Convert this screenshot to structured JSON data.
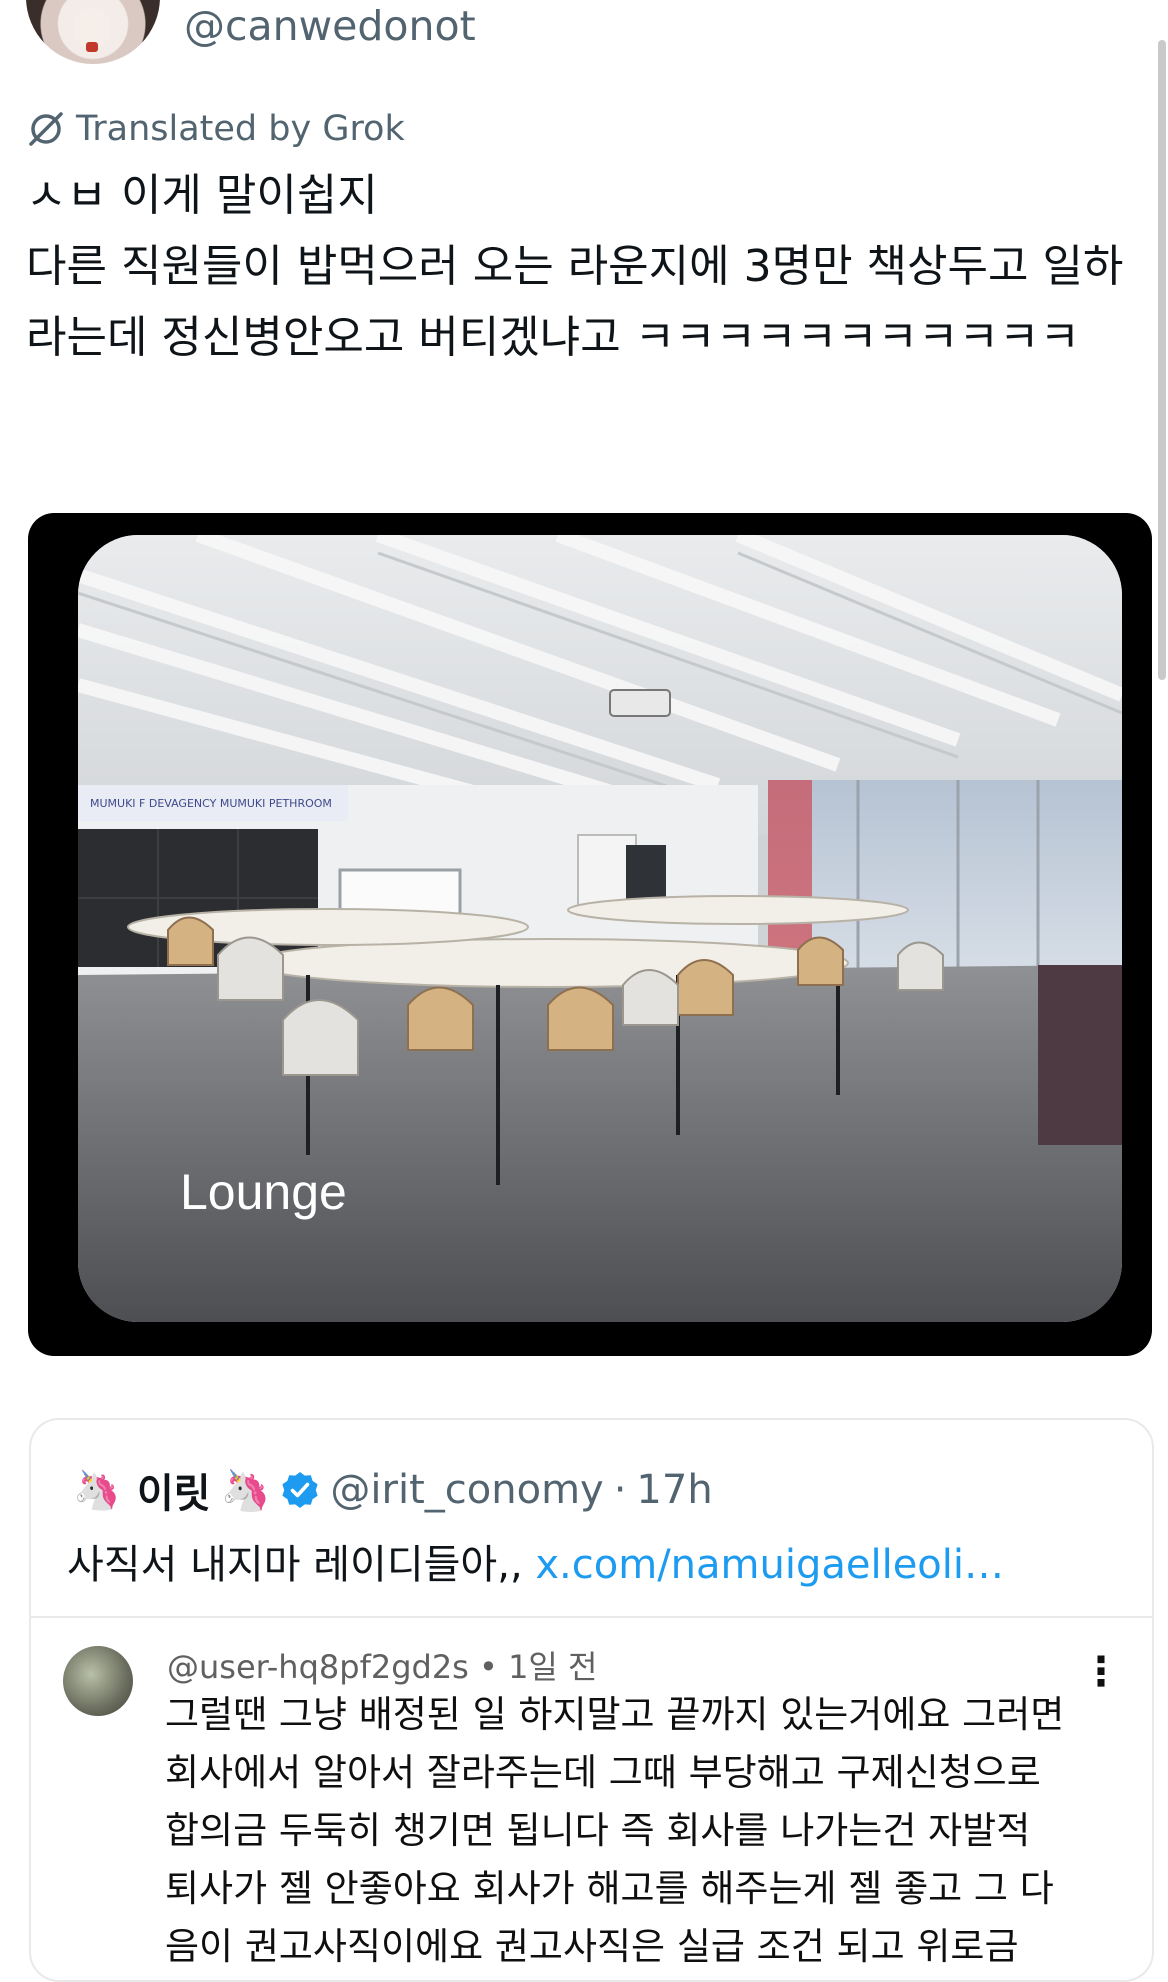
{
  "tweet": {
    "handle": "@canwedonot",
    "translated_label": "Translated by Grok",
    "text": "ㅅㅂ 이게 말이쉽지\n다른 직원들이 밥먹으러 오는 라운지에 3명만 책상두고 일하라는데 정신병안오고 버티겠냐고 ㅋㅋㅋㅋㅋㅋㅋㅋㅋㅋㅋ",
    "image_caption": "Lounge",
    "image_signage": "MUMUKI   F  DEVAGENCY   MUMUKI   PETHROOM"
  },
  "quote": {
    "name": "이릿",
    "name_emoji": "🦄",
    "avatar_emoji": "🦄",
    "handle": "@irit_conomy",
    "separator": "·",
    "time": "17h",
    "text": "사직서 내지마 레이디들아,, ",
    "link": "x.com/namuigaelleoli…",
    "embedded_comment": {
      "user": "@user-hq8pf2gd2s",
      "meta_sep": "•",
      "time": "1일 전",
      "more": "⋮",
      "text": "그럴땐 그냥 배정된 일 하지말고 끝까지 있는거에요 그러면 회사에서 알아서 잘라주는데 그때 부당해고 구제신청으로 합의금 두둑히 챙기면 됩니다 즉 회사를 나가는건 자발적 퇴사가 젤 안좋아요 회사가 해고를 해주는게 젤 좋고 그 다음이 권고사직이에요 권고사직은 실급 조건 되고 위로금"
    }
  },
  "colors": {
    "text_primary": "#0f1419",
    "text_secondary": "#536471",
    "link": "#1d9bf0",
    "verified": "#1d9bf0",
    "border": "#e7e9eb"
  },
  "icons": {
    "translate": "slashed-circle-icon",
    "verified": "verified-badge-icon",
    "more": "more-vertical-icon"
  }
}
